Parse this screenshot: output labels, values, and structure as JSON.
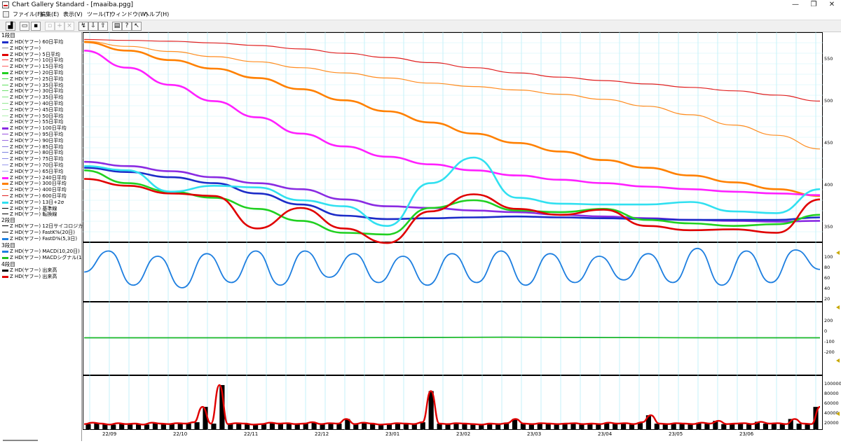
{
  "window": {
    "title": "Chart Gallery Standard - [maaiba.pgg]",
    "minimize": "—",
    "maximize": "❐",
    "close": "✕"
  },
  "menu": [
    "ファイル(F)",
    "編集(E)",
    "表示(V)",
    "ツール(T)",
    "ウィンドウ(W)",
    "ヘルプ(H)"
  ],
  "toolbar": {
    "buttons": [
      "new-chart",
      "open",
      "save",
      "copy",
      "add",
      "delete",
      "chart-wizard",
      "download",
      "upload",
      "print",
      "help",
      "context-help"
    ]
  },
  "legend": {
    "group1_label": "1段目",
    "group1": [
      {
        "label": "Z HD(ヤフー) 60日平均",
        "color": "#1c2cc8",
        "w": 2
      },
      {
        "label": "Z HD(ヤフー)",
        "color": "#888888",
        "w": 1
      },
      {
        "label": "Z HD(ヤフー) 5日平均",
        "color": "#e00000",
        "w": 2
      },
      {
        "label": "Z HD(ヤフー) 10日平均",
        "color": "#ff3030",
        "w": 1
      },
      {
        "label": "Z HD(ヤフー) 15日平均",
        "color": "#ff6060",
        "w": 1
      },
      {
        "label": "Z HD(ヤフー) 20日平均",
        "color": "#20d020",
        "w": 2
      },
      {
        "label": "Z HD(ヤフー) 25日平均",
        "color": "#40d840",
        "w": 1
      },
      {
        "label": "Z HD(ヤフー) 35日平均",
        "color": "#60e060",
        "w": 1
      },
      {
        "label": "Z HD(ヤフー) 30日平均",
        "color": "#70e070",
        "w": 1
      },
      {
        "label": "Z HD(ヤフー) 35日平均",
        "color": "#80e880",
        "w": 1
      },
      {
        "label": "Z HD(ヤフー) 40日平均",
        "color": "#90e890",
        "w": 1
      },
      {
        "label": "Z HD(ヤフー) 45日平均",
        "color": "#a0f0a0",
        "w": 1
      },
      {
        "label": "Z HD(ヤフー) 50日平均",
        "color": "#b0f0b0",
        "w": 1
      },
      {
        "label": "Z HD(ヤフー) 55日平均",
        "color": "#c0f4c0",
        "w": 1
      },
      {
        "label": "Z HD(ヤフー) 100日平均",
        "color": "#8a2be2",
        "w": 2
      },
      {
        "label": "Z HD(ヤフー) 95日平均",
        "color": "#9a50e0",
        "w": 1
      },
      {
        "label": "Z HD(ヤフー) 90日平均",
        "color": "#9a6ae0",
        "w": 1
      },
      {
        "label": "Z HD(ヤフー) 85日平均",
        "color": "#8a7ae0",
        "w": 1
      },
      {
        "label": "Z HD(ヤフー) 80日平均",
        "color": "#7a80e0",
        "w": 1
      },
      {
        "label": "Z HD(ヤフー) 75日平均",
        "color": "#8a8ae8",
        "w": 1
      },
      {
        "label": "Z HD(ヤフー) 70日平均",
        "color": "#9a9aee",
        "w": 1
      },
      {
        "label": "Z HD(ヤフー) 65日平均",
        "color": "#aaaaf2",
        "w": 1
      },
      {
        "label": "Z HD(ヤフー) 240日平均",
        "color": "#ff20ff",
        "w": 2
      },
      {
        "label": "Z HD(ヤフー) 300日平均",
        "color": "#ff8000",
        "w": 2
      },
      {
        "label": "Z HD(ヤフー) 400日平均",
        "color": "#ff8c20",
        "w": 1
      },
      {
        "label": "Z HD(ヤフー) 600日平均",
        "color": "#e02020",
        "w": 1
      },
      {
        "label": "Z HD(ヤフー) 13日+2σ",
        "color": "#30e0f0",
        "w": 2
      },
      {
        "label": "Z HD(ヤフー) 基準線",
        "color": "#000000",
        "w": 1
      },
      {
        "label": "Z HD(ヤフー) 転換線",
        "color": "#000000",
        "w": 1
      }
    ],
    "group2_label": "2段目",
    "group2": [
      {
        "label": "Z HD(ヤフー) 12日サイコロジカ",
        "color": "#000000",
        "w": 1
      },
      {
        "label": "Z HD(ヤフー) FastK%(20日)",
        "color": "#000000",
        "w": 1
      },
      {
        "label": "Z HD(ヤフー) FastD%(5,3日)",
        "color": "#1e7fe0",
        "w": 2
      }
    ],
    "group3_label": "3段目",
    "group3": [
      {
        "label": "Z HD(ヤフー) MACD(10,20日)",
        "color": "#1e7fe0",
        "w": 2
      },
      {
        "label": "Z HD(ヤフー) MACDシグナル(1",
        "color": "#20c020",
        "w": 2
      }
    ],
    "group4_label": "4段目",
    "group4": [
      {
        "label": "Z HD(ヤフー) 出来高",
        "color": "#000000",
        "w": 2
      },
      {
        "label": "Z HD(ヤフー) 出来高",
        "color": "#e00000",
        "w": 2
      }
    ]
  },
  "axes": {
    "price_ticks": [
      "550",
      "500",
      "450",
      "400",
      "350"
    ],
    "stoch_ticks": [
      "100",
      "80",
      "60",
      "40",
      "20"
    ],
    "macd_ticks": [
      "200",
      "0",
      "-100",
      "-200"
    ],
    "volume_ticks": [
      "100000",
      "80000",
      "60000",
      "40000",
      "20000"
    ],
    "x_labels": [
      "22/09",
      "22/10",
      "22/11",
      "22/12",
      "23/01",
      "23/02",
      "23/03",
      "23/04",
      "23/05",
      "23/06"
    ]
  },
  "chart_data": [
    {
      "type": "line",
      "panel": "price",
      "ylim": [
        340,
        575
      ],
      "x_labels": [
        "22/09",
        "22/10",
        "22/11",
        "22/12",
        "23/01",
        "23/02",
        "23/03",
        "23/04",
        "23/05",
        "23/06"
      ],
      "series": [
        {
          "name": "Z HD(ヤフー) 600日平均",
          "color": "#e02020",
          "values": [
            573,
            572,
            571,
            569,
            566,
            562,
            557,
            552,
            546,
            540,
            534,
            529,
            525,
            521,
            517,
            513,
            508,
            501
          ]
        },
        {
          "name": "Z HD(ヤフー) 400日平均",
          "color": "#ff8c20",
          "values": [
            571,
            565,
            559,
            553,
            547,
            540,
            534,
            528,
            522,
            518,
            514,
            509,
            503,
            495,
            485,
            473,
            461,
            445
          ]
        },
        {
          "name": "Z HD(ヤフー) 300日平均",
          "color": "#ff8000",
          "values": [
            570,
            560,
            549,
            539,
            528,
            515,
            502,
            489,
            476,
            463,
            452,
            442,
            432,
            423,
            414,
            406,
            398,
            390
          ]
        },
        {
          "name": "Z HD(ヤフー) 240日平均",
          "color": "#ff20ff",
          "values": [
            560,
            540,
            520,
            501,
            482,
            463,
            448,
            436,
            427,
            420,
            414,
            409,
            405,
            401,
            398,
            395,
            393,
            391
          ]
        },
        {
          "name": "Z HD(ヤフー) 100日平均",
          "color": "#8a2be2",
          "values": [
            430,
            425,
            419,
            412,
            405,
            398,
            386,
            378,
            376,
            373,
            371,
            368,
            366,
            364,
            362,
            361,
            360,
            361
          ]
        },
        {
          "name": "Z HD(ヤフー) 60日平均",
          "color": "#1c2cc8",
          "values": [
            423,
            418,
            412,
            405,
            393,
            380,
            367,
            363,
            364,
            365,
            366,
            365,
            364,
            363,
            362,
            362,
            362,
            365
          ]
        },
        {
          "name": "Z HD(ヤフー) 20日平均",
          "color": "#20d020",
          "values": [
            420,
            405,
            395,
            388,
            375,
            361,
            347,
            345,
            376,
            385,
            373,
            371,
            375,
            362,
            358,
            355,
            357,
            368
          ]
        },
        {
          "name": "Z HD(ヤフー) 5日平均",
          "color": "#e00000",
          "values": [
            410,
            402,
            393,
            390,
            352,
            376,
            352,
            335,
            372,
            392,
            375,
            368,
            374,
            355,
            350,
            351,
            347,
            386
          ]
        },
        {
          "name": "Z HD(ヤフー) 13日+2σ",
          "color": "#30e0f0",
          "values": [
            425,
            420,
            395,
            402,
            400,
            385,
            378,
            355,
            405,
            435,
            388,
            381,
            380,
            380,
            383,
            372,
            370,
            398
          ]
        }
      ]
    },
    {
      "type": "line",
      "panel": "stochastic",
      "ylim": [
        0,
        100
      ],
      "series": [
        {
          "name": "Z HD(ヤフー) FastD%(5,3日)",
          "color": "#1e7fe0",
          "values": [
            50,
            90,
            25,
            80,
            20,
            85,
            30,
            90,
            25,
            90,
            40,
            85,
            30,
            80,
            25,
            85,
            30,
            90,
            25,
            85,
            30,
            80,
            35,
            85,
            30,
            95,
            25,
            90,
            30,
            92,
            55
          ]
        }
      ]
    },
    {
      "type": "line",
      "panel": "macd",
      "ylim": [
        -220,
        210
      ],
      "series": [
        {
          "name": "Z HD(ヤフー) MACD(10,20日)",
          "color": "#1e7fe0",
          "values": [
            0,
            0,
            0,
            2,
            4,
            2,
            0,
            0
          ]
        },
        {
          "name": "Z HD(ヤフー) MACDシグナル(1",
          "color": "#20c020",
          "values": [
            0,
            0,
            0,
            1,
            3,
            1,
            0,
            0
          ]
        }
      ]
    },
    {
      "type": "bar",
      "panel": "volume",
      "ylim": [
        0,
        110000
      ],
      "series": [
        {
          "name": "Z HD(ヤフー) 出来高",
          "color": "#000000",
          "values": [
            11000,
            14000,
            12000,
            10000,
            13000,
            11000,
            12000,
            10000,
            14000,
            12000,
            11000,
            13000,
            12000,
            15000,
            48000,
            12000,
            95000,
            11000,
            13000,
            12000,
            10000,
            11000,
            14000,
            12000,
            13000,
            11000,
            12000,
            15000,
            11000,
            13000,
            12000,
            22000,
            11000,
            14000,
            12000,
            10000,
            11000,
            13000,
            12000,
            11000,
            15000,
            82000,
            12000,
            11000,
            13000,
            12000,
            11000,
            10000,
            12000,
            11000,
            13000,
            22000,
            12000,
            11000,
            13000,
            12000,
            11000,
            12000,
            13000,
            11000,
            12000,
            11000,
            14000,
            12000,
            13000,
            11000,
            15000,
            30000,
            12000,
            11000,
            13000,
            12000,
            11000,
            14000,
            12000,
            18000,
            11000,
            12000,
            13000,
            11000,
            16000,
            12000,
            13000,
            11000,
            22000,
            12000,
            11000,
            48000
          ]
        }
      ]
    }
  ]
}
